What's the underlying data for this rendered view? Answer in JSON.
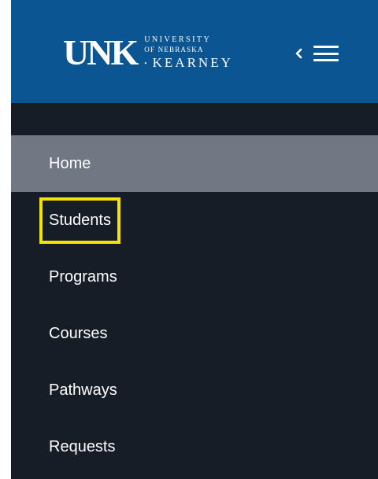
{
  "logo": {
    "mark": "UNK",
    "line1": "UNIVERSITY",
    "line2": "OF NEBRASKA",
    "line3": "KEARNEY"
  },
  "icons": {
    "collapse": "chevron-left-icon",
    "menu": "hamburger-menu-icon"
  },
  "colors": {
    "header": "#0c5593",
    "sidebar": "#171d27",
    "active_item": "#6f7883",
    "highlight": "#f5e400"
  },
  "nav": {
    "items": [
      {
        "label": "Home",
        "active": true
      },
      {
        "label": "Students",
        "highlighted": true
      },
      {
        "label": "Programs"
      },
      {
        "label": "Courses"
      },
      {
        "label": "Pathways"
      },
      {
        "label": "Requests"
      }
    ]
  }
}
